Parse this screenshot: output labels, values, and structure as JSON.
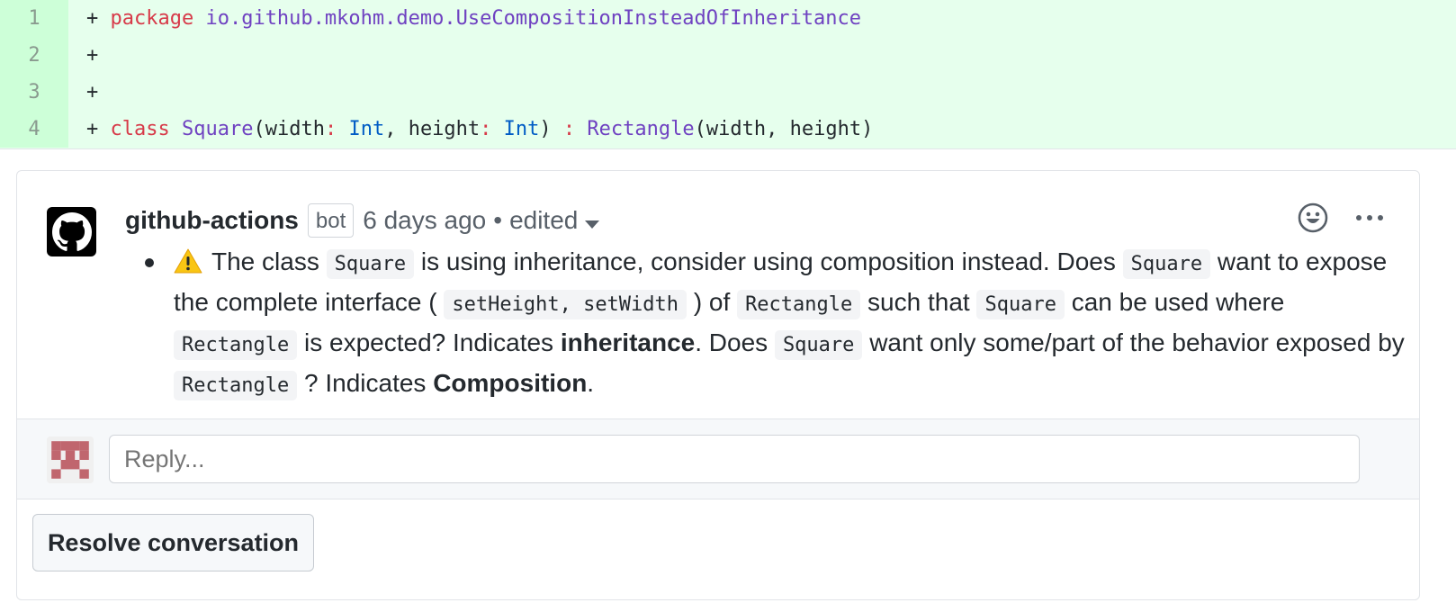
{
  "diff": {
    "lines": [
      {
        "num": "1",
        "plus": "+ ",
        "tokens": [
          {
            "t": "package",
            "c": "kw"
          },
          {
            "t": " io.github.mkohm.demo.UseCompositionInsteadOfInheritance",
            "c": "pk"
          }
        ]
      },
      {
        "num": "2",
        "plus": "+",
        "tokens": []
      },
      {
        "num": "3",
        "plus": "+",
        "tokens": []
      },
      {
        "num": "4",
        "plus": "+ ",
        "tokens": [
          {
            "t": "class",
            "c": "kw"
          },
          {
            "t": " ",
            "c": "pl"
          },
          {
            "t": "Square",
            "c": "pk"
          },
          {
            "t": "(width",
            "c": "pl"
          },
          {
            "t": ":",
            "c": "kw"
          },
          {
            "t": " ",
            "c": "pl"
          },
          {
            "t": "Int",
            "c": "ty"
          },
          {
            "t": ", height",
            "c": "pl"
          },
          {
            "t": ":",
            "c": "kw"
          },
          {
            "t": " ",
            "c": "pl"
          },
          {
            "t": "Int",
            "c": "ty"
          },
          {
            "t": ") ",
            "c": "pl"
          },
          {
            "t": ":",
            "c": "kw"
          },
          {
            "t": " ",
            "c": "pl"
          },
          {
            "t": "Rectangle",
            "c": "pk"
          },
          {
            "t": "(width, height)",
            "c": "pl"
          }
        ]
      }
    ]
  },
  "comment": {
    "author": "github-actions",
    "badge": "bot",
    "time": "6 days ago",
    "separator": "•",
    "edited": "edited",
    "body": {
      "t1": "The class ",
      "c1": "Square",
      "t2": " is using inheritance, consider using composition instead. Does ",
      "c2": "Square",
      "t3": " want to expose the complete interface ( ",
      "c3": "setHeight, setWidth",
      "t4": " ) of ",
      "c4": "Rectangle",
      "t5": " such that ",
      "c5": "Square",
      "t6": " can be used where ",
      "c6": "Rectangle",
      "t7": " is expected? Indicates ",
      "b1": "inheritance",
      "t8": ". Does ",
      "c7": "Square",
      "t9": " want only some/part of the behavior exposed by ",
      "c8": "Rectangle",
      "t10": " ? Indicates ",
      "b2": "Composition",
      "t11": "."
    }
  },
  "reply": {
    "placeholder": "Reply..."
  },
  "actions": {
    "resolve_label": "Resolve conversation"
  },
  "colors": {
    "diff_bg": "#e6ffed",
    "diff_num_bg": "#cdffd8",
    "keyword": "#d73a49",
    "package": "#6f42c1",
    "type": "#005cc5"
  }
}
